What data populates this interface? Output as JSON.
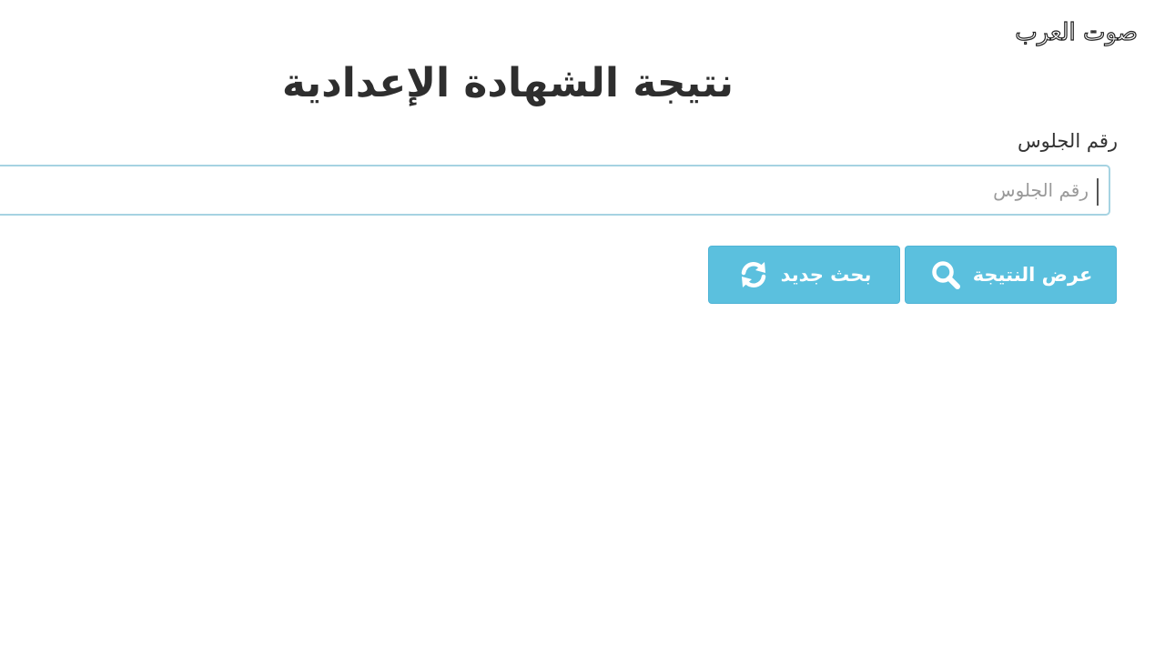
{
  "watermark": {
    "text": "صوت العرب"
  },
  "page": {
    "title": "نتيجة الشهادة الإعدادية"
  },
  "form": {
    "seat_label": "رقم الجلوس",
    "seat_placeholder": "رقم الجلوس",
    "seat_value": ""
  },
  "buttons": {
    "show_result": {
      "label": "عرض النتيجة",
      "icon": "search-icon"
    },
    "new_search": {
      "label": "بحث جديد",
      "icon": "refresh-icon"
    }
  },
  "colors": {
    "button_bg": "#5bc0de",
    "input_border": "#a6d3e2",
    "title_text": "#2e2e2e"
  }
}
